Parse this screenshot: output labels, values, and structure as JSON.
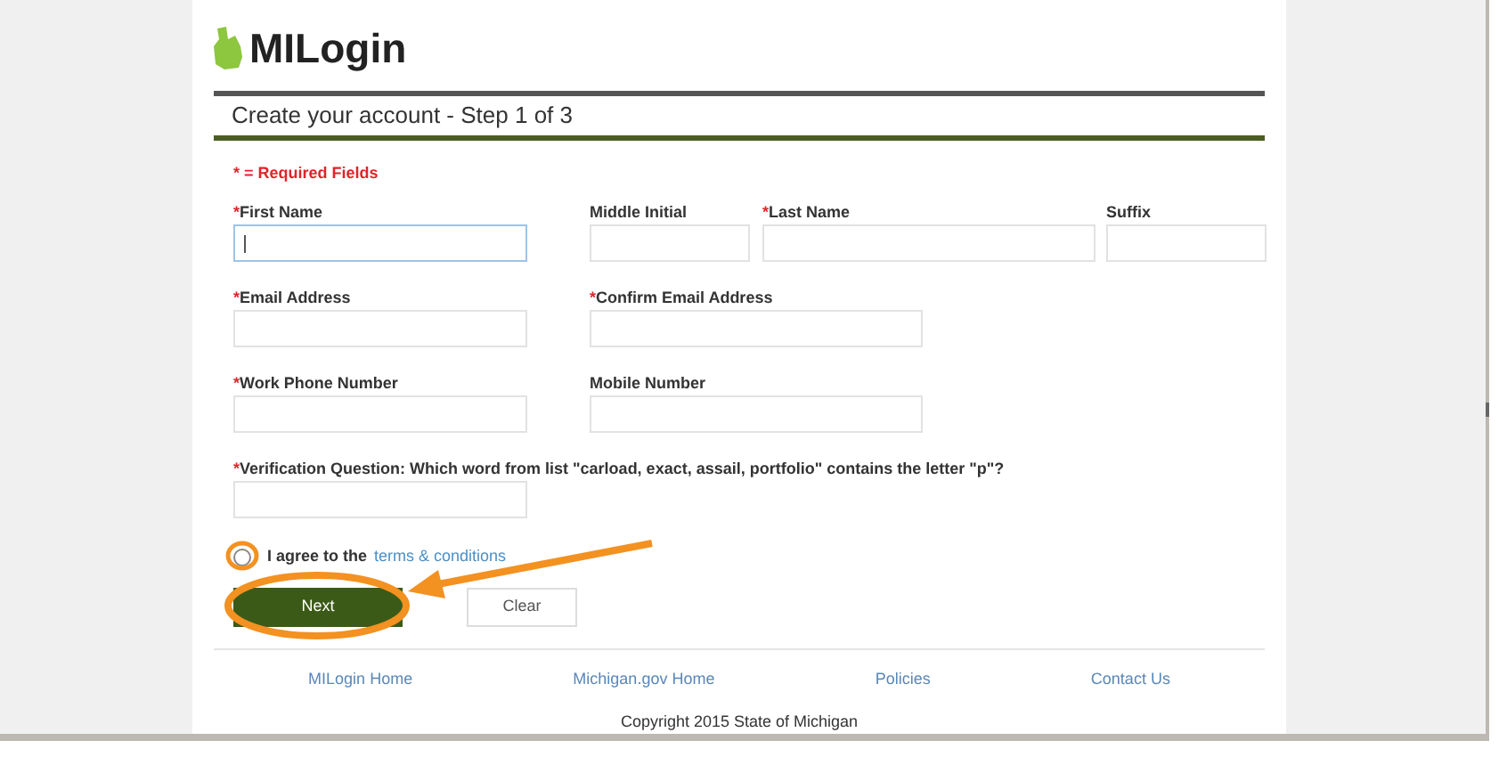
{
  "logo": {
    "text": "MILogin"
  },
  "step_title": "Create your account - Step 1 of 3",
  "required_note": "* = Required Fields",
  "field_rows": [
    {
      "fields": [
        {
          "label": "First Name",
          "mark": "*",
          "focused": true
        },
        {
          "label": "Middle Initial",
          "focused": false
        },
        {
          "label": "Last Name",
          "mark": "*",
          "focused": false
        },
        {
          "label": "Suffix",
          "focused": false
        }
      ]
    },
    {
      "fields": [
        {
          "label": "Email Address",
          "mark": "*",
          "focused": false
        },
        {
          "label": "Confirm Email Address",
          "mark": "*",
          "focused": false
        }
      ]
    },
    {
      "fields": [
        {
          "label": "Work Phone Number",
          "mark": "*",
          "focused": false
        },
        {
          "label": "Mobile Number",
          "focused": false
        }
      ]
    },
    {
      "fields": [
        {
          "label": "Verification Question: Which word from list \"carload, exact, assail, portfolio\" contains the letter \"p\"?",
          "mark": "*",
          "focused": false
        }
      ]
    }
  ],
  "agreement": {
    "checked": false,
    "text": "I agree to the",
    "link": "terms & conditions"
  },
  "buttons": [
    {
      "label": "Next",
      "kind": "primary"
    },
    {
      "label": "Clear",
      "kind": "secondary"
    }
  ],
  "footer_links": [
    "MILogin Home",
    "Michigan.gov Home",
    "Policies",
    "Contact Us"
  ],
  "copyright": "Copyright 2015 State of Michigan"
}
